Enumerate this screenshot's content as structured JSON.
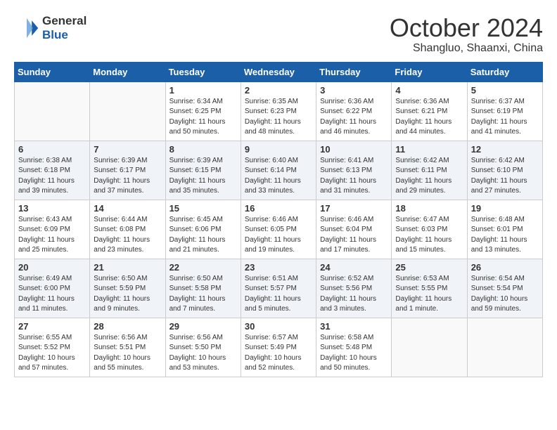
{
  "header": {
    "logo_line1": "General",
    "logo_line2": "Blue",
    "month": "October 2024",
    "location": "Shangluo, Shaanxi, China"
  },
  "columns": [
    "Sunday",
    "Monday",
    "Tuesday",
    "Wednesday",
    "Thursday",
    "Friday",
    "Saturday"
  ],
  "weeks": [
    [
      {
        "day": "",
        "content": ""
      },
      {
        "day": "",
        "content": ""
      },
      {
        "day": "1",
        "content": "Sunrise: 6:34 AM\nSunset: 6:25 PM\nDaylight: 11 hours and 50 minutes."
      },
      {
        "day": "2",
        "content": "Sunrise: 6:35 AM\nSunset: 6:23 PM\nDaylight: 11 hours and 48 minutes."
      },
      {
        "day": "3",
        "content": "Sunrise: 6:36 AM\nSunset: 6:22 PM\nDaylight: 11 hours and 46 minutes."
      },
      {
        "day": "4",
        "content": "Sunrise: 6:36 AM\nSunset: 6:21 PM\nDaylight: 11 hours and 44 minutes."
      },
      {
        "day": "5",
        "content": "Sunrise: 6:37 AM\nSunset: 6:19 PM\nDaylight: 11 hours and 41 minutes."
      }
    ],
    [
      {
        "day": "6",
        "content": "Sunrise: 6:38 AM\nSunset: 6:18 PM\nDaylight: 11 hours and 39 minutes."
      },
      {
        "day": "7",
        "content": "Sunrise: 6:39 AM\nSunset: 6:17 PM\nDaylight: 11 hours and 37 minutes."
      },
      {
        "day": "8",
        "content": "Sunrise: 6:39 AM\nSunset: 6:15 PM\nDaylight: 11 hours and 35 minutes."
      },
      {
        "day": "9",
        "content": "Sunrise: 6:40 AM\nSunset: 6:14 PM\nDaylight: 11 hours and 33 minutes."
      },
      {
        "day": "10",
        "content": "Sunrise: 6:41 AM\nSunset: 6:13 PM\nDaylight: 11 hours and 31 minutes."
      },
      {
        "day": "11",
        "content": "Sunrise: 6:42 AM\nSunset: 6:11 PM\nDaylight: 11 hours and 29 minutes."
      },
      {
        "day": "12",
        "content": "Sunrise: 6:42 AM\nSunset: 6:10 PM\nDaylight: 11 hours and 27 minutes."
      }
    ],
    [
      {
        "day": "13",
        "content": "Sunrise: 6:43 AM\nSunset: 6:09 PM\nDaylight: 11 hours and 25 minutes."
      },
      {
        "day": "14",
        "content": "Sunrise: 6:44 AM\nSunset: 6:08 PM\nDaylight: 11 hours and 23 minutes."
      },
      {
        "day": "15",
        "content": "Sunrise: 6:45 AM\nSunset: 6:06 PM\nDaylight: 11 hours and 21 minutes."
      },
      {
        "day": "16",
        "content": "Sunrise: 6:46 AM\nSunset: 6:05 PM\nDaylight: 11 hours and 19 minutes."
      },
      {
        "day": "17",
        "content": "Sunrise: 6:46 AM\nSunset: 6:04 PM\nDaylight: 11 hours and 17 minutes."
      },
      {
        "day": "18",
        "content": "Sunrise: 6:47 AM\nSunset: 6:03 PM\nDaylight: 11 hours and 15 minutes."
      },
      {
        "day": "19",
        "content": "Sunrise: 6:48 AM\nSunset: 6:01 PM\nDaylight: 11 hours and 13 minutes."
      }
    ],
    [
      {
        "day": "20",
        "content": "Sunrise: 6:49 AM\nSunset: 6:00 PM\nDaylight: 11 hours and 11 minutes."
      },
      {
        "day": "21",
        "content": "Sunrise: 6:50 AM\nSunset: 5:59 PM\nDaylight: 11 hours and 9 minutes."
      },
      {
        "day": "22",
        "content": "Sunrise: 6:50 AM\nSunset: 5:58 PM\nDaylight: 11 hours and 7 minutes."
      },
      {
        "day": "23",
        "content": "Sunrise: 6:51 AM\nSunset: 5:57 PM\nDaylight: 11 hours and 5 minutes."
      },
      {
        "day": "24",
        "content": "Sunrise: 6:52 AM\nSunset: 5:56 PM\nDaylight: 11 hours and 3 minutes."
      },
      {
        "day": "25",
        "content": "Sunrise: 6:53 AM\nSunset: 5:55 PM\nDaylight: 11 hours and 1 minute."
      },
      {
        "day": "26",
        "content": "Sunrise: 6:54 AM\nSunset: 5:54 PM\nDaylight: 10 hours and 59 minutes."
      }
    ],
    [
      {
        "day": "27",
        "content": "Sunrise: 6:55 AM\nSunset: 5:52 PM\nDaylight: 10 hours and 57 minutes."
      },
      {
        "day": "28",
        "content": "Sunrise: 6:56 AM\nSunset: 5:51 PM\nDaylight: 10 hours and 55 minutes."
      },
      {
        "day": "29",
        "content": "Sunrise: 6:56 AM\nSunset: 5:50 PM\nDaylight: 10 hours and 53 minutes."
      },
      {
        "day": "30",
        "content": "Sunrise: 6:57 AM\nSunset: 5:49 PM\nDaylight: 10 hours and 52 minutes."
      },
      {
        "day": "31",
        "content": "Sunrise: 6:58 AM\nSunset: 5:48 PM\nDaylight: 10 hours and 50 minutes."
      },
      {
        "day": "",
        "content": ""
      },
      {
        "day": "",
        "content": ""
      }
    ]
  ]
}
